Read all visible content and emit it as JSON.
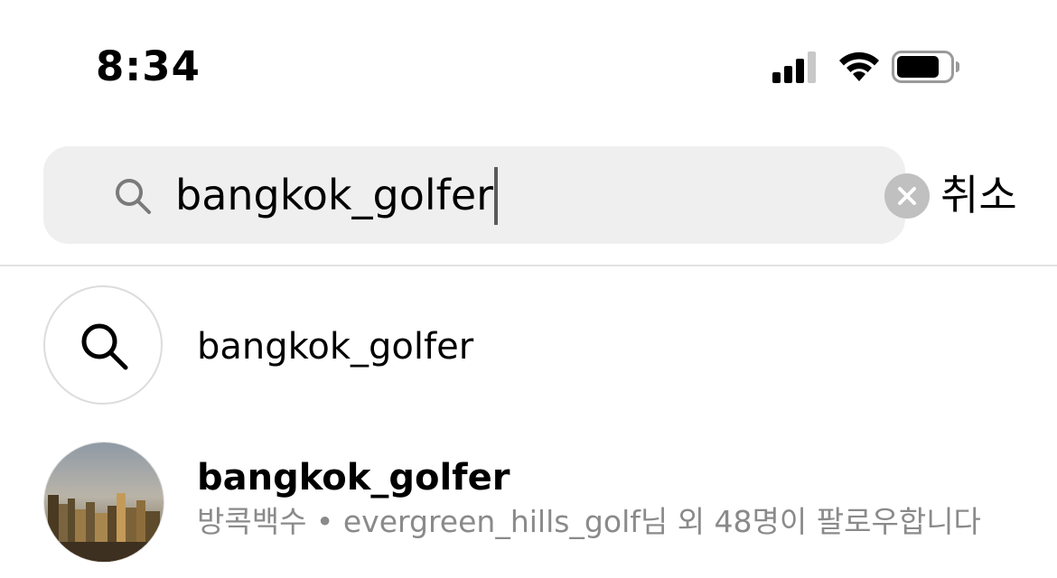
{
  "status_bar": {
    "time": "8:34",
    "icons": [
      "signal-icon",
      "wifi-icon",
      "battery-icon"
    ]
  },
  "search": {
    "query": "bangkok_golfer",
    "cancel_label": "취소",
    "icons": [
      "search-icon",
      "clear-icon"
    ]
  },
  "results": {
    "search_suggestion": {
      "label": "bangkok_golfer",
      "icon": "search-icon"
    },
    "account": {
      "username": "bangkok_golfer",
      "subtitle": "방콕백수 • evergreen_hills_golf님 외 48명이 팔로우합니다"
    }
  },
  "colors": {
    "search_bg": "#efefef",
    "subtitle_text": "#8a8a8a",
    "divider": "#e2e2e2",
    "clear_button": "#c0c0c0"
  }
}
